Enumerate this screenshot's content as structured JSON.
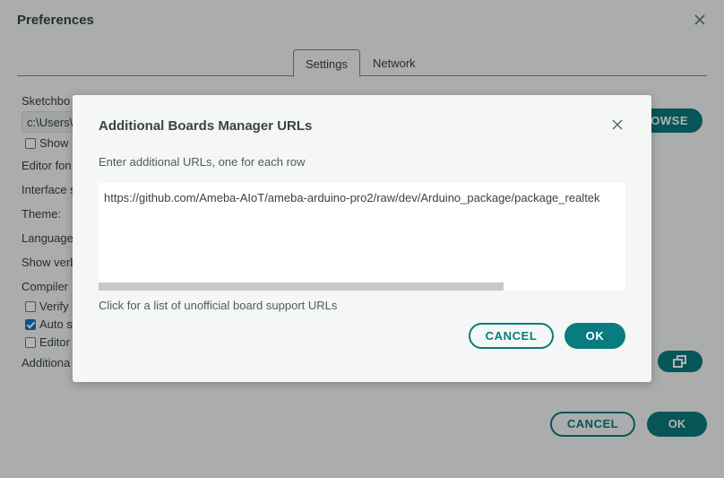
{
  "preferences": {
    "title": "Preferences",
    "tabs": [
      {
        "label": "Settings",
        "active": true
      },
      {
        "label": "Network",
        "active": false
      }
    ],
    "labels": {
      "sketchbook": "Sketchbo",
      "sketchbook_path": "c:\\Users\\",
      "show": "Show",
      "editor_font": "Editor fon",
      "interface": "Interface s",
      "theme": "Theme:",
      "language": "Language",
      "show_verbose": "Show verb",
      "compiler": "Compiler",
      "verify": "Verify",
      "auto": "Auto s",
      "editor": "Editor",
      "additional": "Additiona"
    },
    "checkboxes": {
      "show": false,
      "verify": false,
      "auto": true,
      "editor": false
    },
    "browse_button": "OWSE",
    "cancel_button": "CANCEL",
    "ok_button": "OK"
  },
  "modal": {
    "title": "Additional Boards Manager URLs",
    "description": "Enter additional URLs, one for each row",
    "urls": "https://github.com/Ameba-AIoT/ameba-arduino-pro2/raw/dev/Arduino_package/package_realtek",
    "link": "Click for a list of unofficial board support URLs",
    "cancel_button": "CANCEL",
    "ok_button": "OK"
  },
  "colors": {
    "accent": "#0a7b7f",
    "background": "#f5f6f6"
  }
}
